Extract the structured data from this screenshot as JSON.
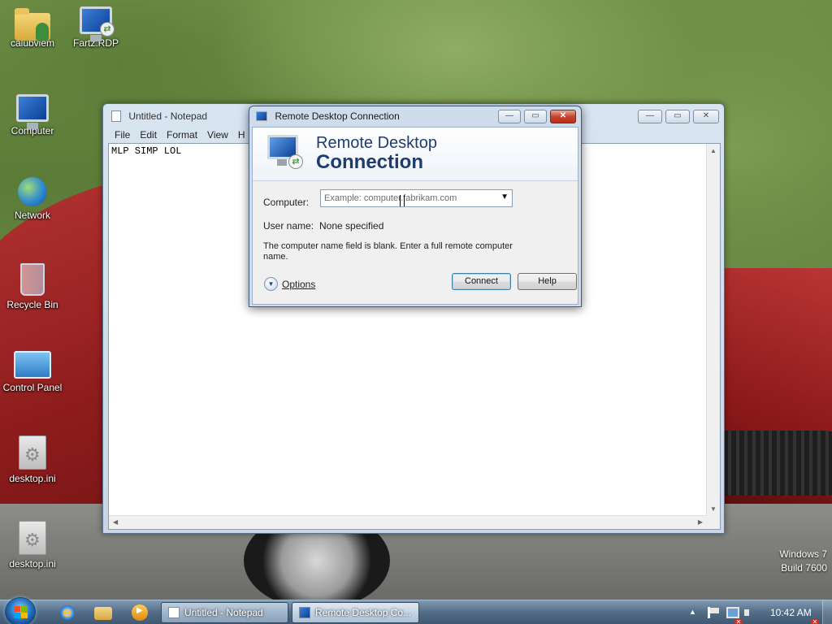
{
  "desktop": {
    "icons": [
      {
        "label": "calubviem",
        "icon": "user-folder-icon"
      },
      {
        "label": "Fartz.RDP",
        "icon": "rdp-file-icon"
      },
      {
        "label": "Computer",
        "icon": "computer-icon"
      },
      {
        "label": "Network",
        "icon": "network-icon"
      },
      {
        "label": "Recycle Bin",
        "icon": "recycle-bin-icon"
      },
      {
        "label": "Control Panel",
        "icon": "control-panel-icon"
      },
      {
        "label": "desktop.ini",
        "icon": "ini-file-icon"
      },
      {
        "label": "desktop.ini",
        "icon": "ini-file-icon"
      }
    ],
    "build_line1": "Windows 7",
    "build_line2": "Build 7600"
  },
  "notepad": {
    "title": "Untitled - Notepad",
    "menu": [
      "File",
      "Edit",
      "Format",
      "View",
      "H"
    ],
    "content": "MLP SIMP LOL"
  },
  "rdp_dialog": {
    "title": "Remote Desktop Connection",
    "heading_line1": "Remote Desktop",
    "heading_line2": "Connection",
    "computer_label": "Computer:",
    "computer_placeholder": "Example: computer.fabrikam.com",
    "username_label": "User name:",
    "username_value": "None specified",
    "message": "The computer name field is blank. Enter a full remote computer name.",
    "options_label": "Options",
    "connect_label": "Connect",
    "help_label": "Help"
  },
  "taskbar": {
    "tasks": [
      {
        "label": "Untitled - Notepad"
      },
      {
        "label": "Remote Desktop Co..."
      }
    ],
    "clock": "10:42 AM"
  },
  "colors": {
    "taskbar": "#4e6882",
    "dialog_heading": "#1e3c6e",
    "wallpaper_grass": "#6e8e46",
    "car_red": "#b63434"
  }
}
